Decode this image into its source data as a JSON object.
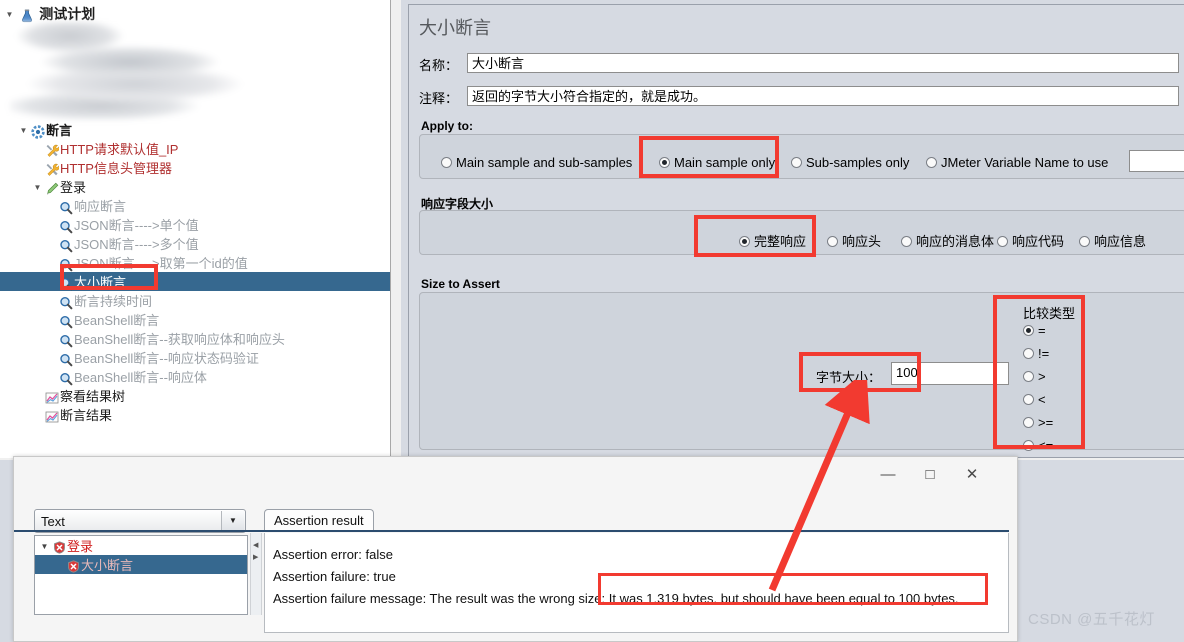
{
  "tree": {
    "root": {
      "label": "测试计划",
      "icon": "test-plan-icon"
    },
    "redacted_note": "",
    "items": [
      {
        "label": "断言",
        "icon": "assertions-group-icon",
        "indent": 2,
        "twisty": "▼",
        "style": "bold",
        "id": "assertions-group"
      },
      {
        "label": "HTTP请求默认值_IP",
        "icon": "config-wrench-icon",
        "indent": 3,
        "twisty": "",
        "style": "red",
        "id": "http-request-defaults"
      },
      {
        "label": "HTTP信息头管理器",
        "icon": "config-wrench-icon",
        "indent": 3,
        "twisty": "",
        "style": "red",
        "id": "http-header-manager"
      },
      {
        "label": "登录",
        "icon": "sampler-icon",
        "indent": 3,
        "twisty": "▼",
        "style": "normal",
        "id": "login-sampler"
      },
      {
        "label": "响应断言",
        "icon": "assertion-magnifier-icon",
        "indent": 4,
        "twisty": "",
        "style": "grey",
        "id": "response-assertion"
      },
      {
        "label": "JSON断言---->单个值",
        "icon": "assertion-magnifier-icon",
        "indent": 4,
        "twisty": "",
        "style": "grey",
        "id": "json-assertion-single"
      },
      {
        "label": "JSON断言---->多个值",
        "icon": "assertion-magnifier-icon",
        "indent": 4,
        "twisty": "",
        "style": "grey",
        "id": "json-assertion-multi"
      },
      {
        "label": "JSON断言---->取第一个id的值",
        "icon": "assertion-magnifier-icon",
        "indent": 4,
        "twisty": "",
        "style": "grey",
        "id": "json-assertion-first-id"
      },
      {
        "label": "大小断言",
        "icon": "assertion-magnifier-icon",
        "indent": 4,
        "twisty": "",
        "style": "selected",
        "id": "size-assertion"
      },
      {
        "label": "断言持续时间",
        "icon": "assertion-magnifier-icon",
        "indent": 4,
        "twisty": "",
        "style": "grey",
        "id": "duration-assertion"
      },
      {
        "label": "BeanShell断言",
        "icon": "assertion-magnifier-icon",
        "indent": 4,
        "twisty": "",
        "style": "grey",
        "id": "beanshell-assertion"
      },
      {
        "label": "BeanShell断言--获取响应体和响应头",
        "icon": "assertion-magnifier-icon",
        "indent": 4,
        "twisty": "",
        "style": "grey",
        "id": "beanshell-body-headers"
      },
      {
        "label": "BeanShell断言--响应状态码验证",
        "icon": "assertion-magnifier-icon",
        "indent": 4,
        "twisty": "",
        "style": "grey",
        "id": "beanshell-status-code"
      },
      {
        "label": "BeanShell断言--响应体",
        "icon": "assertion-magnifier-icon",
        "indent": 4,
        "twisty": "",
        "style": "grey",
        "id": "beanshell-response-body"
      },
      {
        "label": "察看结果树",
        "icon": "listener-chart-icon",
        "indent": 3,
        "twisty": "",
        "style": "normal",
        "id": "view-results-tree"
      },
      {
        "label": "断言结果",
        "icon": "listener-chart-icon",
        "indent": 3,
        "twisty": "",
        "style": "normal",
        "id": "assertion-results"
      }
    ]
  },
  "detail": {
    "title": "大小断言",
    "name_label": "名称：",
    "name_value": "大小断言",
    "comment_label": "注释：",
    "comment_value": "返回的字节大小符合指定的，就是成功。",
    "apply_to": {
      "title": "Apply to:",
      "options": [
        {
          "label": "Main sample and sub-samples",
          "selected": false
        },
        {
          "label": "Main sample only",
          "selected": true
        },
        {
          "label": "Sub-samples only",
          "selected": false
        },
        {
          "label": "JMeter Variable Name to use",
          "selected": false
        }
      ],
      "variable_value": ""
    },
    "response_field": {
      "title": "响应字段大小",
      "options": [
        {
          "label": "完整响应",
          "selected": true
        },
        {
          "label": "响应头",
          "selected": false
        },
        {
          "label": "响应的消息体",
          "selected": false
        },
        {
          "label": "响应代码",
          "selected": false
        },
        {
          "label": "响应信息",
          "selected": false
        }
      ]
    },
    "size_to_assert": {
      "title": "Size to Assert",
      "byte_label": "字节大小：",
      "byte_value": "100",
      "compare_title": "比较类型",
      "compare_options": [
        {
          "label": "=",
          "selected": true
        },
        {
          "label": "!=",
          "selected": false
        },
        {
          "label": ">",
          "selected": false
        },
        {
          "label": "<",
          "selected": false
        },
        {
          "label": ">=",
          "selected": false
        },
        {
          "label": "<=",
          "selected": false
        }
      ]
    }
  },
  "result_window": {
    "minimize": "—",
    "maximize": "□",
    "close": "✕",
    "combo_value": "Text",
    "tree": [
      {
        "label": "登录",
        "twisty": "▼",
        "selected": false
      },
      {
        "label": "大小断言",
        "twisty": "",
        "selected": true
      }
    ],
    "tab_label": "Assertion result",
    "lines": [
      "Assertion error: false",
      "Assertion failure: true",
      "Assertion failure message: The result was the wrong size: It was 1,319 bytes, but should have been equal to 100 bytes."
    ],
    "highlighted_fragment": "It was 1,319 bytes, but should have been equal to 100 bytes."
  },
  "watermark": "CSDN @五千花灯",
  "colors": {
    "annotation_red": "#f23a30",
    "selection_blue": "#36688f",
    "panel_grey": "#d6dae2",
    "group_fill": "#cfd4dc"
  }
}
